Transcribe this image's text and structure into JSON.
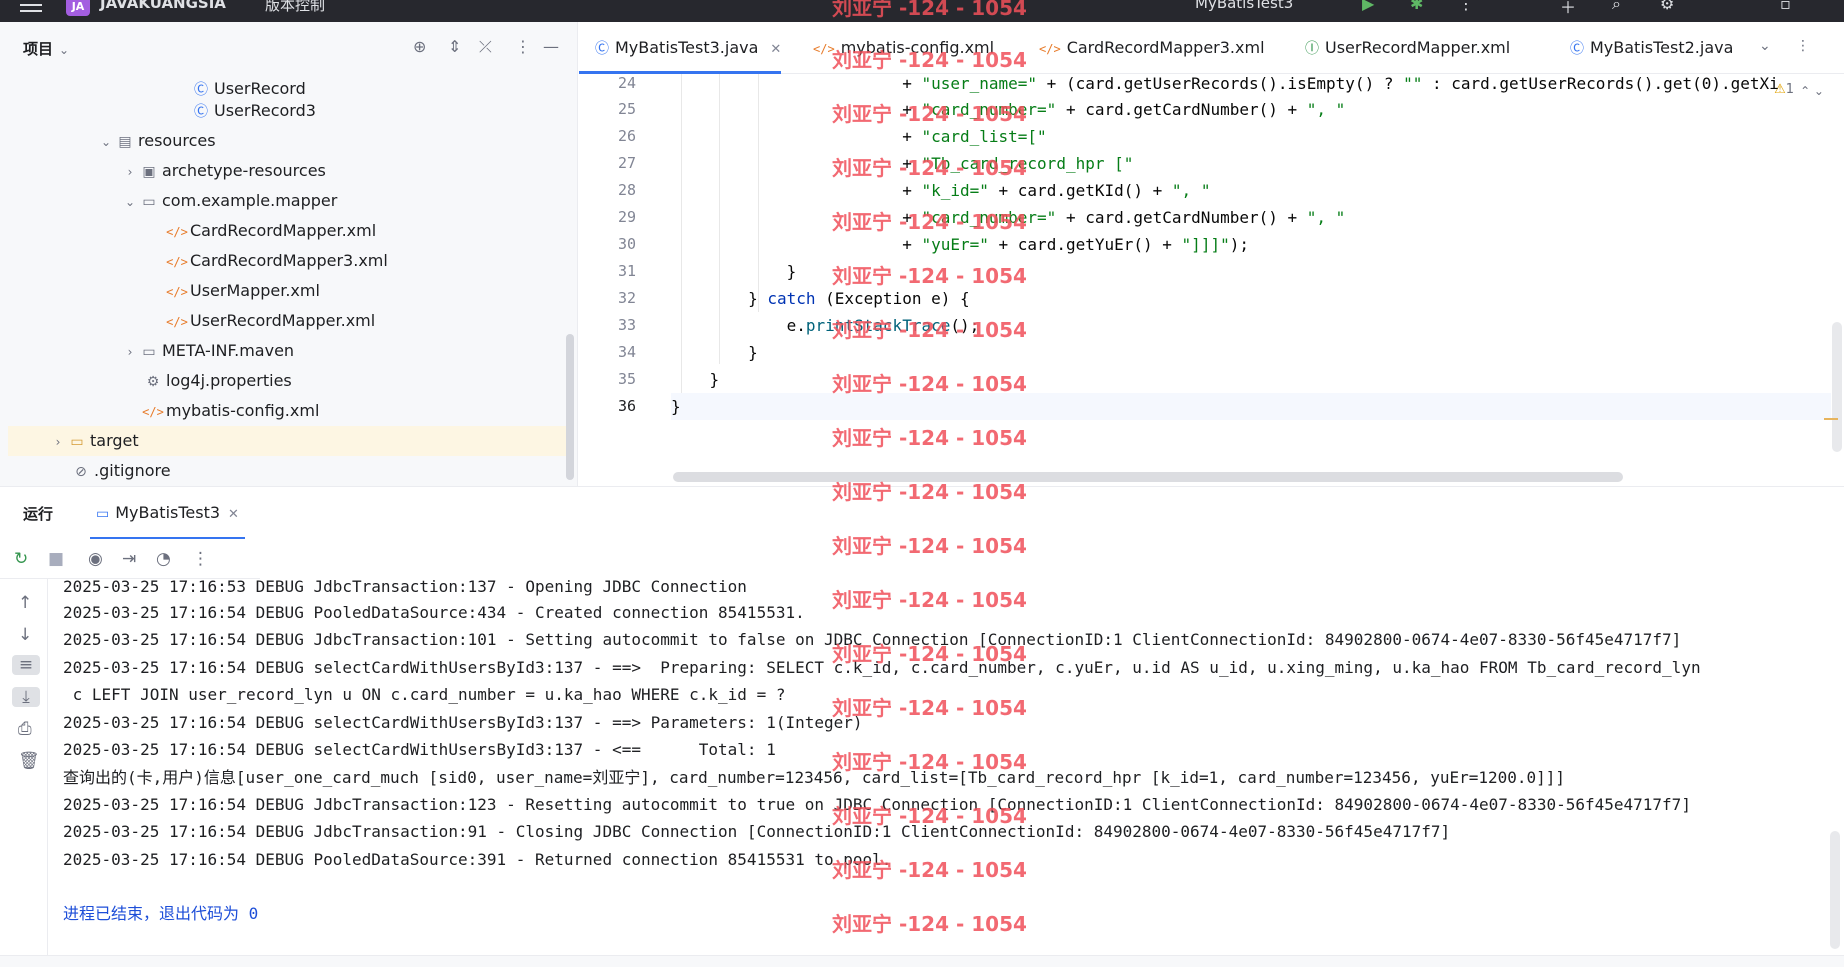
{
  "titlebar": {
    "project_badge": "JA",
    "project_name": "JAVAKUANGSIA",
    "vcs": "版本控制",
    "run_config": "MyBatisTest3"
  },
  "project_panel": {
    "title": "项目",
    "tree": [
      {
        "label": "UserRecord",
        "icon": "class-icon",
        "arrow": ""
      },
      {
        "label": "UserRecord3",
        "icon": "class-icon",
        "arrow": ""
      },
      {
        "label": "resources",
        "icon": "resources-folder-icon",
        "arrow": "down"
      },
      {
        "label": "archetype-resources",
        "icon": "folder-icon",
        "arrow": "right"
      },
      {
        "label": "com.example.mapper",
        "icon": "folder-icon",
        "arrow": "down"
      },
      {
        "label": "CardRecordMapper.xml",
        "icon": "xml-icon",
        "arrow": ""
      },
      {
        "label": "CardRecordMapper3.xml",
        "icon": "xml-icon",
        "arrow": ""
      },
      {
        "label": "UserMapper.xml",
        "icon": "xml-icon",
        "arrow": ""
      },
      {
        "label": "UserRecordMapper.xml",
        "icon": "xml-icon",
        "arrow": ""
      },
      {
        "label": "META-INF.maven",
        "icon": "folder-icon",
        "arrow": "right"
      },
      {
        "label": "log4j.properties",
        "icon": "gear-icon",
        "arrow": ""
      },
      {
        "label": "mybatis-config.xml",
        "icon": "xml-icon",
        "arrow": ""
      },
      {
        "label": "target",
        "icon": "folder-icon",
        "arrow": "right"
      },
      {
        "label": ".gitignore",
        "icon": "ignore-icon",
        "arrow": ""
      }
    ]
  },
  "editor": {
    "tabs": [
      {
        "label": "MyBatisTest3.java",
        "icon": "class-icon"
      },
      {
        "label": "mybatis-config.xml",
        "icon": "xml-icon"
      },
      {
        "label": "CardRecordMapper3.xml",
        "icon": "xml-icon"
      },
      {
        "label": "UserRecordMapper.xml",
        "icon": "interface-icon"
      },
      {
        "label": "MyBatisTest2.java",
        "icon": "class-icon"
      }
    ],
    "warning_count": "1",
    "lines": [
      {
        "num": "24",
        "text": "                        + \"user_name=\" + (card.getUserRecords().isEmpty() ? \"\" : card.getUserRecords().get(0).getXi"
      },
      {
        "num": "25",
        "text": "                        + \"card_number=\" + card.getCardNumber() + \", \""
      },
      {
        "num": "26",
        "text": "                        + \"card_list=[\""
      },
      {
        "num": "27",
        "text": "                        + \"Tb_card_record_hpr [\""
      },
      {
        "num": "28",
        "text": "                        + \"k_id=\" + card.getKId() + \", \""
      },
      {
        "num": "29",
        "text": "                        + \"card_number=\" + card.getCardNumber() + \", \""
      },
      {
        "num": "30",
        "text": "                        + \"yuEr=\" + card.getYuEr() + \"]]]\");"
      },
      {
        "num": "31",
        "text": "            }"
      },
      {
        "num": "32",
        "text": "        } catch (Exception e) {"
      },
      {
        "num": "33",
        "text": "            e.printStackTrace();"
      },
      {
        "num": "34",
        "text": "        }"
      },
      {
        "num": "35",
        "text": "    }"
      },
      {
        "num": "36",
        "text": "}"
      }
    ]
  },
  "run_panel": {
    "title": "运行",
    "tab_label": "MyBatisTest3",
    "console": [
      "2025-03-25 17:16:53 DEBUG JdbcTransaction:137 - Opening JDBC Connection",
      "2025-03-25 17:16:54 DEBUG PooledDataSource:434 - Created connection 85415531.",
      "2025-03-25 17:16:54 DEBUG JdbcTransaction:101 - Setting autocommit to false on JDBC Connection [ConnectionID:1 ClientConnectionId: 84902800-0674-4e07-8330-56f45e4717f7]",
      "2025-03-25 17:16:54 DEBUG selectCardWithUsersById3:137 - ==>  Preparing: SELECT c.k_id, c.card_number, c.yuEr, u.id AS u_id, u.xing_ming, u.ka_hao FROM Tb_card_record_lyn",
      " c LEFT JOIN user_record_lyn u ON c.card_number = u.ka_hao WHERE c.k_id = ?",
      "2025-03-25 17:16:54 DEBUG selectCardWithUsersById3:137 - ==> Parameters: 1(Integer)",
      "2025-03-25 17:16:54 DEBUG selectCardWithUsersById3:137 - <==      Total: 1",
      "查询出的(卡,用户)信息[user_one_card_much [sid0, user_name=刘亚宁], card_number=123456, card_list=[Tb_card_record_hpr [k_id=1, card_number=123456, yuEr=1200.0]]]",
      "2025-03-25 17:16:54 DEBUG JdbcTransaction:123 - Resetting autocommit to true on JDBC Connection [ConnectionID:1 ClientConnectionId: 84902800-0674-4e07-8330-56f45e4717f7]",
      "2025-03-25 17:16:54 DEBUG JdbcTransaction:91 - Closing JDBC Connection [ConnectionID:1 ClientConnectionId: 84902800-0674-4e07-8330-56f45e4717f7]",
      "2025-03-25 17:16:54 DEBUG PooledDataSource:391 - Returned connection 85415531 to pool.",
      "",
      "进程已结束，退出代码为 0"
    ]
  },
  "watermark": "刘亚宁 -124 - 1054",
  "colors": {
    "accent": "#3574f0",
    "string": "#067d17",
    "keyword": "#0033b3",
    "watermark": "#f0505a"
  }
}
